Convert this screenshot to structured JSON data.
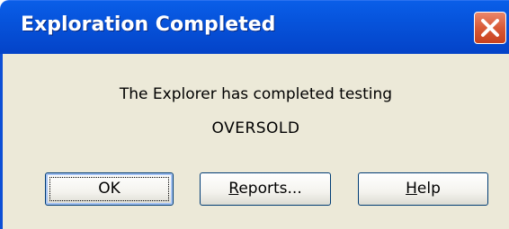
{
  "window": {
    "title": "Exploration Completed",
    "close_icon": "close-icon"
  },
  "message": {
    "line1": "The Explorer has completed testing",
    "line2": "OVERSOLD"
  },
  "buttons": {
    "ok": {
      "label": "OK"
    },
    "reports": {
      "mnemonic": "R",
      "rest": "eports..."
    },
    "help": {
      "mnemonic": "H",
      "rest": "elp"
    }
  },
  "colors": {
    "titlebar": "#0653db",
    "close_button": "#d95a37",
    "dialog_face": "#ece9d8"
  }
}
